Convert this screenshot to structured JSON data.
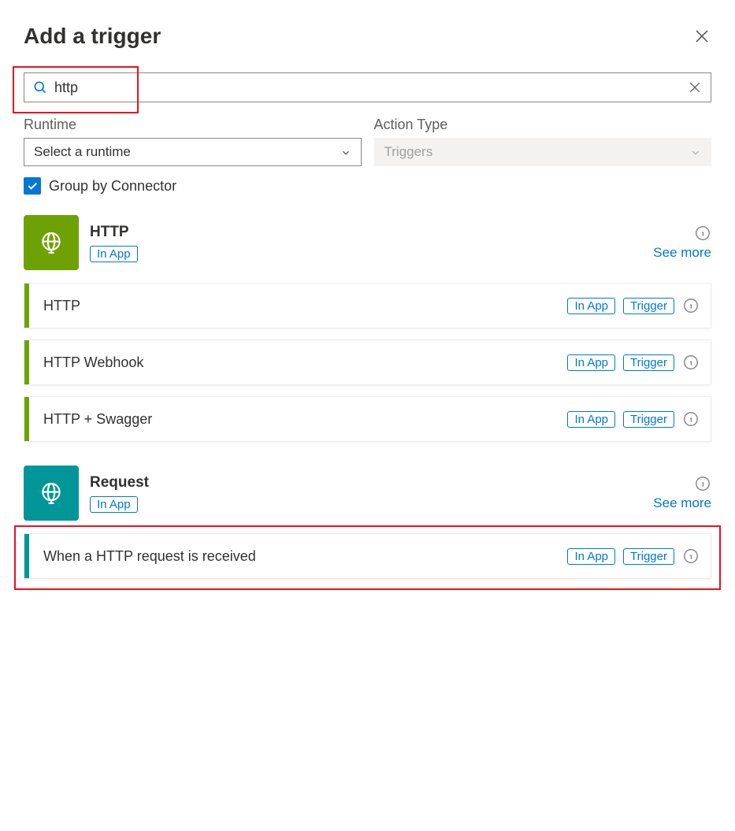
{
  "title": "Add a trigger",
  "search": {
    "value": "http"
  },
  "filters": {
    "runtime": {
      "label": "Runtime",
      "placeholder": "Select a runtime"
    },
    "actionType": {
      "label": "Action Type",
      "value": "Triggers"
    }
  },
  "group": {
    "label": "Group by Connector",
    "checked": true
  },
  "seeMore": "See more",
  "pills": {
    "inApp": "In App",
    "trigger": "Trigger"
  },
  "connectors": [
    {
      "key": "http",
      "name": "HTTP",
      "color": "http",
      "items": [
        {
          "label": "HTTP"
        },
        {
          "label": "HTTP Webhook"
        },
        {
          "label": "HTTP + Swagger"
        }
      ]
    },
    {
      "key": "request",
      "name": "Request",
      "color": "request",
      "items": [
        {
          "label": "When a HTTP request is received",
          "highlight": true
        }
      ]
    }
  ]
}
